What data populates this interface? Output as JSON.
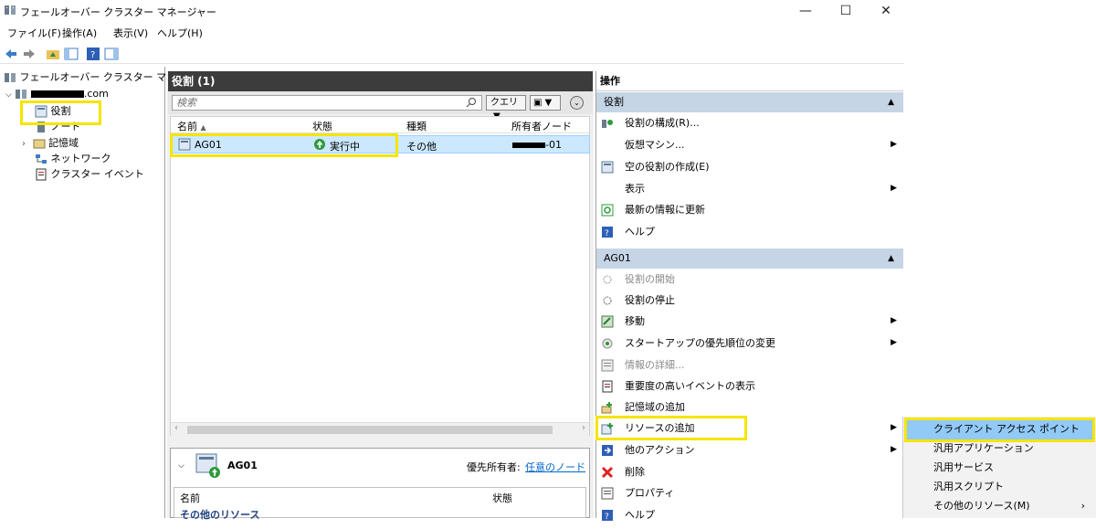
{
  "window": {
    "title": "フェールオーバー クラスター マネージャー",
    "controls": {
      "minimize": "—",
      "maximize": "☐",
      "close": "✕"
    }
  },
  "menu": [
    "ファイル(F)",
    "操作(A)",
    "表示(V)",
    "ヘルプ(H)"
  ],
  "tree": {
    "root": "フェールオーバー クラスター マネージャ",
    "cluster_suffix": ".com",
    "items": [
      "役割",
      "ノード",
      "記憶域",
      "ネットワーク",
      "クラスター イベント"
    ]
  },
  "roles_panel": {
    "title": "役割 (1)",
    "search_placeholder": "検索",
    "query_button": "クエリ",
    "columns": [
      "名前",
      "状態",
      "種類",
      "所有者ノード"
    ],
    "rows": [
      {
        "name": "AG01",
        "status": "実行中",
        "type": "その他",
        "owner": "-01"
      }
    ]
  },
  "detail_panel": {
    "name": "AG01",
    "preferred_owner_label": "優先所有者:",
    "preferred_owner_link": "任意のノード",
    "columns": [
      "名前",
      "状態"
    ],
    "group_label": "その他のリソース"
  },
  "actions": {
    "title": "操作",
    "section_roles": "役割",
    "roles_items": [
      "役割の構成(R)...",
      "仮想マシン...",
      "空の役割の作成(E)",
      "表示",
      "最新の情報に更新",
      "ヘルプ"
    ],
    "section_ag": "AG01",
    "ag_items": [
      "役割の開始",
      "役割の停止",
      "移動",
      "スタートアップの優先順位の変更",
      "情報の詳細...",
      "重要度の高いイベントの表示",
      "記憶域の追加",
      "リソースの追加",
      "他のアクション",
      "削除",
      "プロパティ",
      "ヘルプ"
    ]
  },
  "submenu": [
    "クライアント アクセス ポイント",
    "汎用アプリケーション",
    "汎用サービス",
    "汎用スクリプト",
    "その他のリソース(M)"
  ],
  "colors": {
    "highlight": "#f5e500",
    "selected_row": "#cce8ff",
    "section_bg": "#c5d5e6",
    "header_dark": "#3c3c3c"
  }
}
